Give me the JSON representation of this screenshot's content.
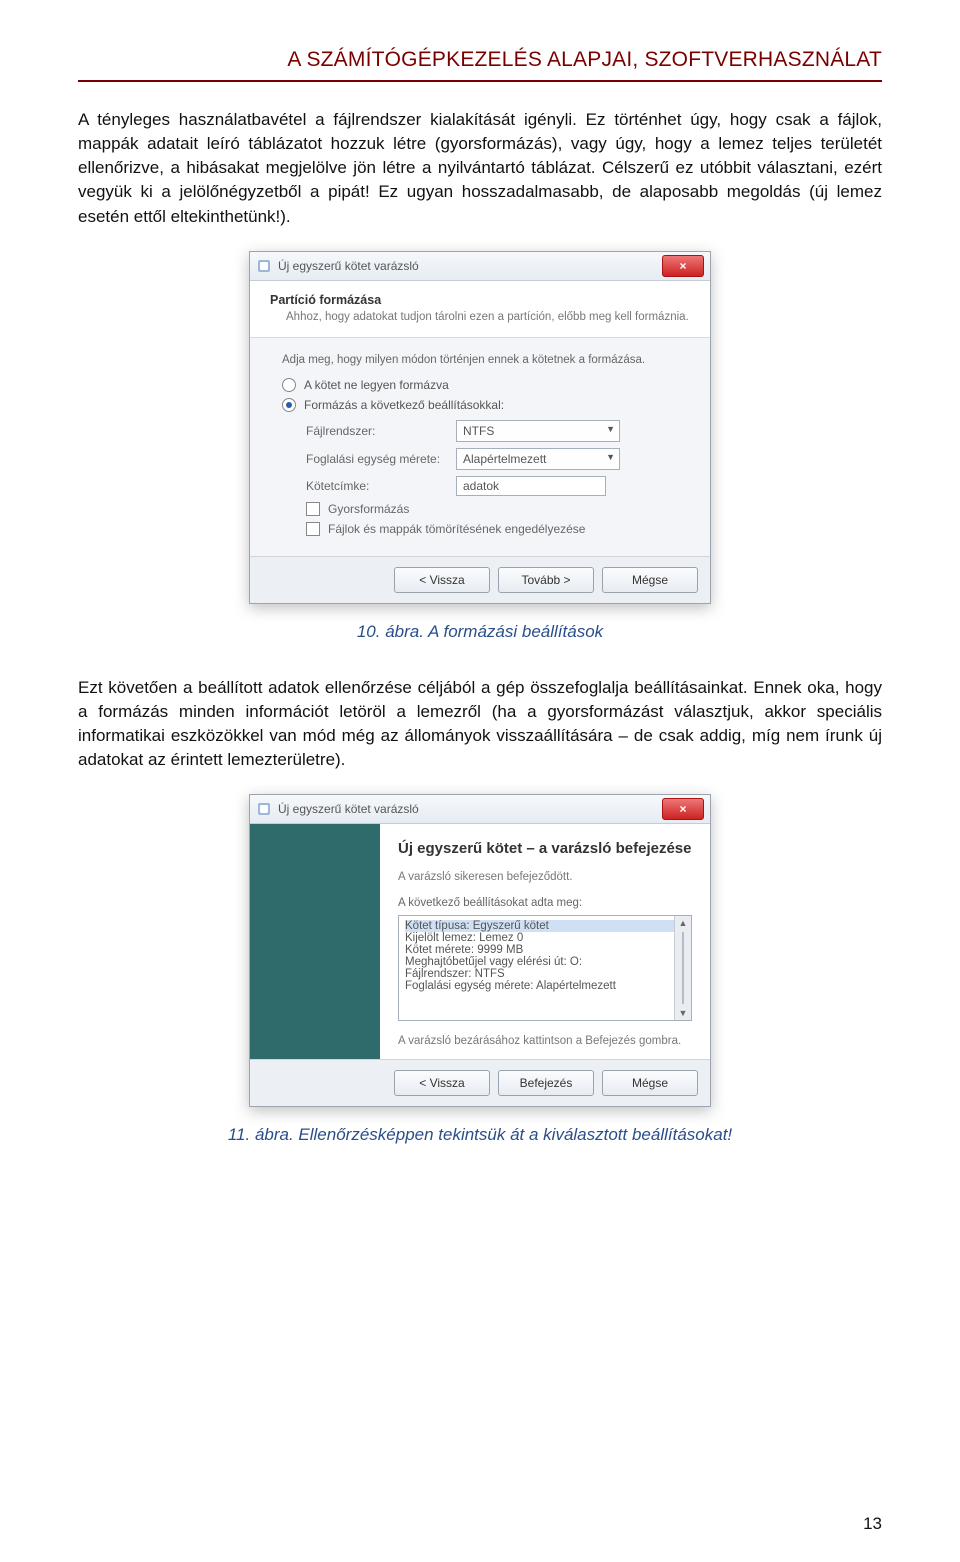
{
  "header_title": "A SZÁMÍTÓGÉPKEZELÉS ALAPJAI, SZOFTVERHASZNÁLAT",
  "para1": "A tényleges használatbavétel a fájlrendszer kialakítását igényli. Ez történhet úgy, hogy csak a fájlok, mappák adatait leíró táblázatot hozzuk létre (gyorsformázás), vagy úgy, hogy a lemez teljes területét ellenőrizve, a hibásakat megjelölve jön létre a nyilvántartó táblázat. Célszerű ez utóbbit választani, ezért vegyük ki a jelölőnégyzetből a pipát! Ez ugyan hosszadalmasabb, de alaposabb megoldás (új lemez esetén ettől eltekinthetünk!).",
  "caption1": "10. ábra. A formázási beállítások",
  "para2": "Ezt követően a beállított adatok ellenőrzése céljából a gép összefoglalja beállításainkat. Ennek oka, hogy a formázás minden információt letöröl a lemezről (ha a gyorsformázást választjuk, akkor speciális informatikai eszközökkel van mód még az állományok visszaállítására – de csak addig, míg nem írunk új adatokat az érintett lemezterületre).",
  "caption2": "11. ábra. Ellenőrzésképpen tekintsük át a kiválasztott beállításokat!",
  "page_number": "13",
  "wiz1": {
    "title": "Új egyszerű kötet varázsló",
    "close_x": "×",
    "head_title": "Partíció formázása",
    "head_sub": "Ahhoz, hogy adatokat tudjon tárolni ezen a partíción, előbb meg kell formáznia.",
    "prompt": "Adja meg, hogy milyen módon történjen ennek a kötetnek a formázása.",
    "radio_none": "A kötet ne legyen formázva",
    "radio_format": "Formázás a következő beállításokkal:",
    "label_fs": "Fájlrendszer:",
    "value_fs": "NTFS",
    "label_alloc": "Foglalási egység mérete:",
    "value_alloc": "Alapértelmezett",
    "label_vol": "Kötetcímke:",
    "value_vol": "adatok",
    "chk_quick": "Gyorsformázás",
    "chk_compress": "Fájlok és mappák tömörítésének engedélyezése",
    "btn_back": "< Vissza",
    "btn_next": "Tovább >",
    "btn_cancel": "Mégse"
  },
  "wiz2": {
    "title": "Új egyszerű kötet varázsló",
    "close_x": "×",
    "heading": "Új egyszerű kötet – a varázsló befejezése",
    "done_msg": "A varázsló sikeresen befejeződött.",
    "list_label": "A következő beállításokat adta meg:",
    "items": {
      "l0": "Kötet típusa: Egyszerű kötet",
      "l1": "Kijelölt lemez: Lemez 0",
      "l2": "Kötet mérete: 9999 MB",
      "l3": "Meghajtóbetűjel vagy elérési út: O:",
      "l4": "Fájlrendszer: NTFS",
      "l5": "Foglalási egység mérete: Alapértelmezett"
    },
    "hint": "A varázsló bezárásához kattintson a Befejezés gombra.",
    "btn_back": "< Vissza",
    "btn_finish": "Befejezés",
    "btn_cancel": "Mégse"
  }
}
